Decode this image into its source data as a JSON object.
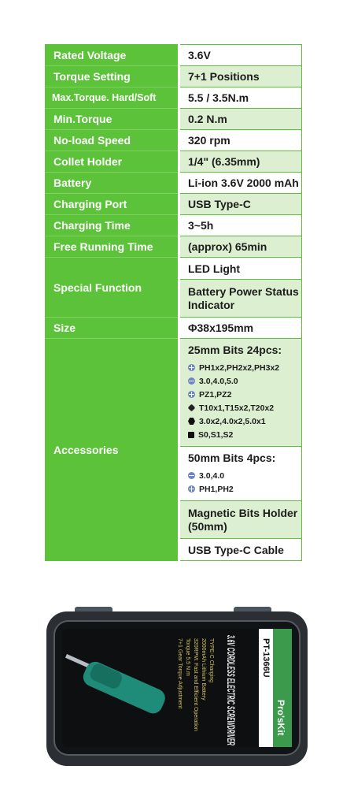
{
  "specs": {
    "rated_voltage": {
      "label": "Rated Voltage",
      "value": "3.6V"
    },
    "torque_setting": {
      "label": "Torque Setting",
      "value": "7+1 Positions"
    },
    "max_torque": {
      "label": "Max.Torque. Hard/Soft",
      "value": "5.5 / 3.5N.m"
    },
    "min_torque": {
      "label": "Min.Torque",
      "value": "0.2 N.m"
    },
    "no_load_speed": {
      "label": "No-load Speed",
      "value": "320 rpm"
    },
    "collet_holder": {
      "label": "Collet Holder",
      "value": "1/4\" (6.35mm)"
    },
    "battery": {
      "label": "Battery",
      "value": "Li-ion 3.6V 2000 mAh"
    },
    "charging_port": {
      "label": "Charging Port",
      "value": "USB Type-C"
    },
    "charging_time": {
      "label": "Charging Time",
      "value": "3~5h"
    },
    "free_running_time": {
      "label": "Free Running Time",
      "value": "(approx) 65min"
    },
    "special_function": {
      "label": "Special Function",
      "values": [
        "LED Light",
        "Battery Power Status Indicator"
      ]
    },
    "size": {
      "label": "Size",
      "value": "Φ38x195mm"
    },
    "accessories": {
      "label": "Accessories",
      "bits25": {
        "title": "25mm Bits 24pcs:",
        "items": [
          {
            "icon": "phillips-icon",
            "text": "PH1x2,PH2x2,PH3x2"
          },
          {
            "icon": "slotted-icon",
            "text": "3.0,4.0,5.0"
          },
          {
            "icon": "phillips-icon",
            "text": "PZ1,PZ2"
          },
          {
            "icon": "torx-icon",
            "text": "T10x1,T15x2,T20x2"
          },
          {
            "icon": "hex-icon",
            "text": "3.0x2,4.0x2,5.0x1"
          },
          {
            "icon": "square-icon",
            "text": "S0,S1,S2"
          }
        ]
      },
      "bits50": {
        "title": "50mm Bits 4pcs:",
        "items": [
          {
            "icon": "slotted-icon",
            "text": "3.0,4.0"
          },
          {
            "icon": "phillips-icon",
            "text": "PH1,PH2"
          }
        ]
      },
      "holder": "Magnetic Bits Holder (50mm)",
      "cable": "USB Type-C Cable"
    }
  },
  "product": {
    "brand": "Pro'sKit",
    "model": "PT-1366U",
    "name": "3.6V CORDLESS ELECTRIC SCREWDRIVER",
    "features": [
      "7+1 Gear Torque Adjustment",
      "Torque 5.5 N.m",
      "320RPM: Fast and Efficient Operation",
      "2000mAh Lithium Battery",
      "TYPE-C Charging"
    ]
  },
  "colors": {
    "green": "#5cc23a",
    "light_green": "#dcefd0",
    "tool_teal": "#1e8c78"
  }
}
